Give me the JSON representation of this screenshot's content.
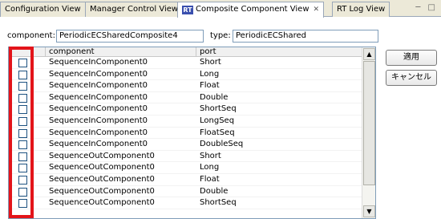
{
  "tabs": [
    {
      "label": "Configuration View",
      "active": false
    },
    {
      "label": "Manager Control View",
      "active": false
    },
    {
      "label": "Composite Component View",
      "active": true,
      "icon": "RT",
      "close": "✕"
    },
    {
      "label": "RT Log View",
      "active": false
    }
  ],
  "window_controls": "─ □",
  "component_field": {
    "label": "component:",
    "value": "PeriodicECSharedComposite4"
  },
  "type_field": {
    "label": "type:",
    "value": "PeriodicECShared"
  },
  "table": {
    "columns": [
      "component",
      "port"
    ],
    "rows": [
      {
        "component": "SequenceInComponent0",
        "port": "Short",
        "checked": false
      },
      {
        "component": "SequenceInComponent0",
        "port": "Long",
        "checked": false
      },
      {
        "component": "SequenceInComponent0",
        "port": "Float",
        "checked": false
      },
      {
        "component": "SequenceInComponent0",
        "port": "Double",
        "checked": false
      },
      {
        "component": "SequenceInComponent0",
        "port": "ShortSeq",
        "checked": false
      },
      {
        "component": "SequenceInComponent0",
        "port": "LongSeq",
        "checked": false
      },
      {
        "component": "SequenceInComponent0",
        "port": "FloatSeq",
        "checked": false
      },
      {
        "component": "SequenceInComponent0",
        "port": "DoubleSeq",
        "checked": false
      },
      {
        "component": "SequenceOutComponent0",
        "port": "Short",
        "checked": false
      },
      {
        "component": "SequenceOutComponent0",
        "port": "Long",
        "checked": false
      },
      {
        "component": "SequenceOutComponent0",
        "port": "Float",
        "checked": false
      },
      {
        "component": "SequenceOutComponent0",
        "port": "Double",
        "checked": false
      },
      {
        "component": "SequenceOutComponent0",
        "port": "ShortSeq",
        "checked": false
      }
    ]
  },
  "buttons": {
    "apply": "適用",
    "cancel": "キャンセル"
  },
  "highlight_color": "#e3141a"
}
